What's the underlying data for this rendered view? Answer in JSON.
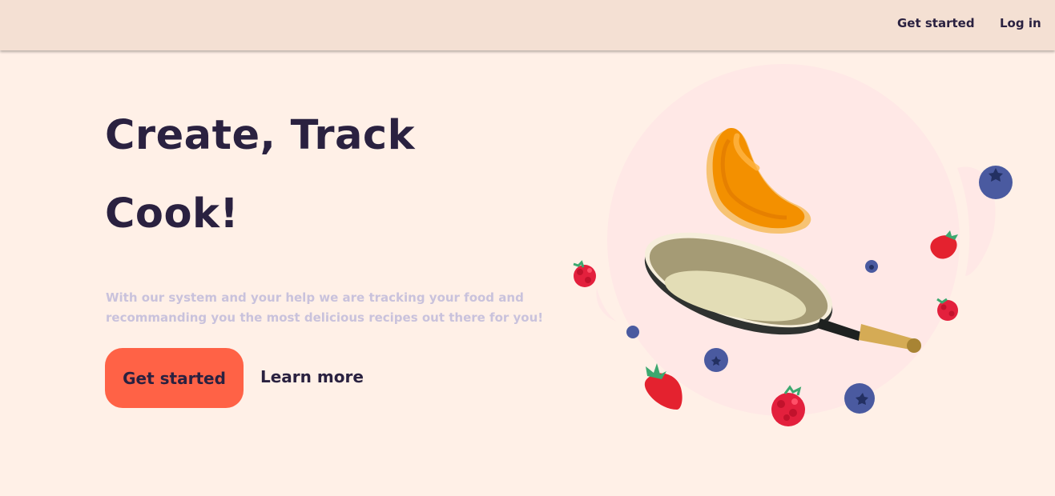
{
  "nav": {
    "get_started": "Get started",
    "log_in": "Log in"
  },
  "hero": {
    "title_line1": "Create, Track",
    "title_line2": "Cook!",
    "description": "With our system and your help we are tracking your food and recommanding you the most delicious recipes out there for you!",
    "primary_button": "Get started",
    "secondary_button": "Learn more"
  },
  "illustration": {
    "icons": [
      "pan-icon",
      "pancake-icon",
      "blueberry-icon",
      "strawberry-icon",
      "raspberry-icon"
    ]
  },
  "colors": {
    "background": "#fff0e7",
    "topbar": "#f4e0d3",
    "text_dark": "#2a2140",
    "text_muted": "#c9c2dc",
    "accent": "#ff6246"
  }
}
